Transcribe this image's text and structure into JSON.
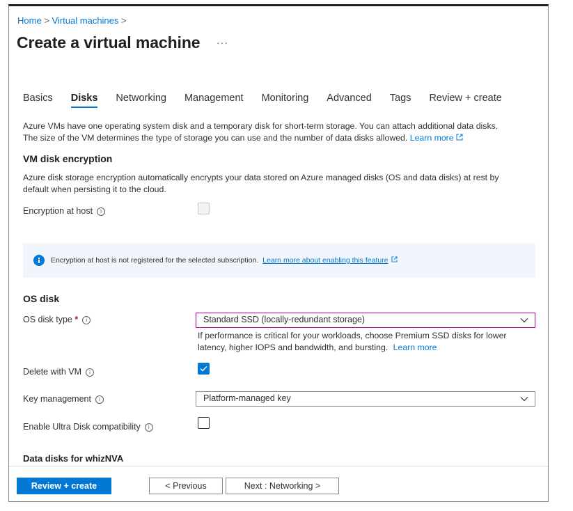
{
  "breadcrumb": {
    "home": "Home",
    "sep": ">",
    "vms": "Virtual machines"
  },
  "title": "Create a virtual machine",
  "title_more": "···",
  "tabs": [
    {
      "label": "Basics"
    },
    {
      "label": "Disks",
      "active": true
    },
    {
      "label": "Networking"
    },
    {
      "label": "Management"
    },
    {
      "label": "Monitoring"
    },
    {
      "label": "Advanced"
    },
    {
      "label": "Tags"
    },
    {
      "label": "Review + create"
    }
  ],
  "intro": {
    "line1": "Azure VMs have one operating system disk and a temporary disk for short-term storage. You can attach additional data disks.",
    "line2": "The size of the VM determines the type of storage you can use and the number of data disks allowed.",
    "learn_more": "Learn more"
  },
  "encryption": {
    "heading": "VM disk encryption",
    "desc1": "Azure disk storage encryption automatically encrypts your data stored on Azure managed disks (OS and data disks) at rest by",
    "desc2": "default when persisting it to the cloud.",
    "host_label": "Encryption at host",
    "banner_text": "Encryption at host is not registered for the selected subscription.",
    "banner_link": "Learn more about enabling this feature"
  },
  "os_disk": {
    "heading": "OS disk",
    "type_label": "OS disk type",
    "required_mark": "*",
    "type_value": "Standard SSD (locally-redundant storage)",
    "hint1": "If performance is critical for your workloads, choose Premium SSD disks for lower",
    "hint2": "latency, higher IOPS and bandwidth, and bursting.",
    "hint_link": "Learn more",
    "delete_label": "Delete with VM",
    "delete_checked": true,
    "key_label": "Key management",
    "key_value": "Platform-managed key",
    "ultra_label": "Enable Ultra Disk compatibility",
    "ultra_checked": false
  },
  "data_disks": {
    "heading": "Data disks for whizNVA"
  },
  "footer": {
    "review": "Review + create",
    "previous": "< Previous",
    "next": "Next : Networking >"
  },
  "colors": {
    "accent": "#0078d4",
    "required": "#a4262c",
    "focus_border": "#b4009e",
    "banner_bg": "#f0f6fc"
  }
}
